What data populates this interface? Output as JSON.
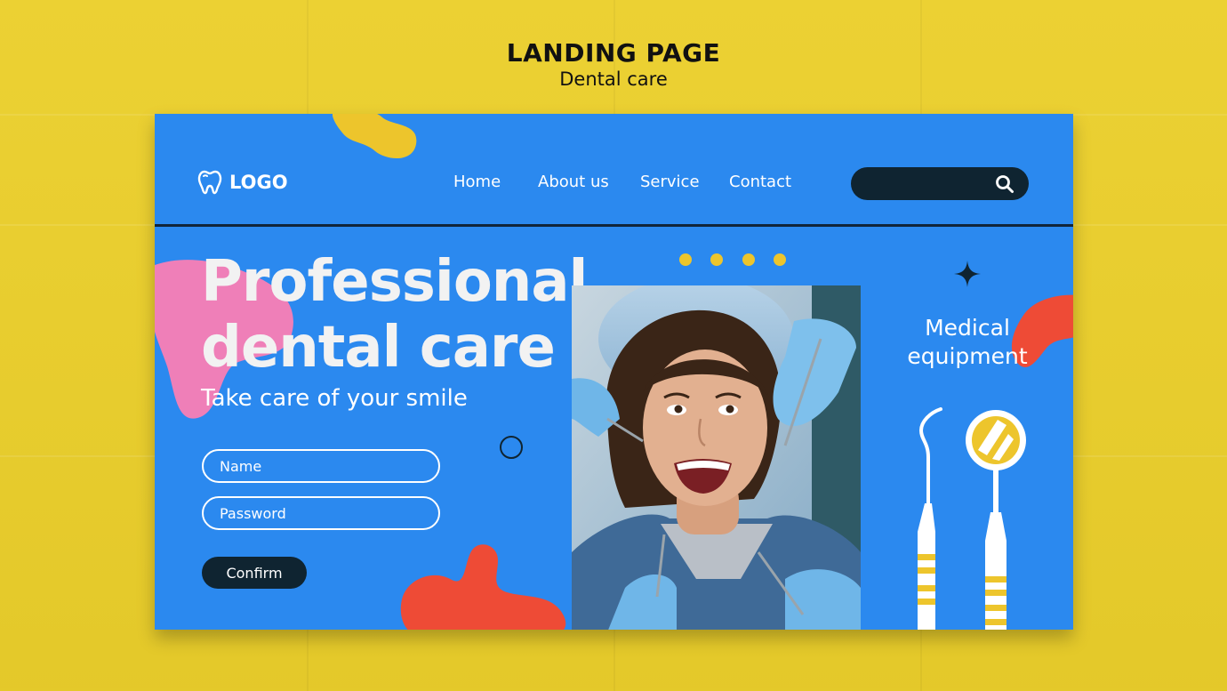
{
  "mockup": {
    "title": "LANDING PAGE",
    "subtitle": "Dental care"
  },
  "nav": {
    "logo_text": "LOGO",
    "links": [
      "Home",
      "About us",
      "Service",
      "Contact"
    ],
    "search_placeholder": ""
  },
  "hero": {
    "title_line1": "Professional",
    "title_line2": "dental care",
    "subtitle": "Take care of your smile"
  },
  "form": {
    "name_placeholder": "Name",
    "password_placeholder": "Password",
    "confirm_label": "Confirm"
  },
  "side": {
    "title_line1": "Medical",
    "title_line2": "equipment"
  },
  "colors": {
    "background": "#ebcf2b",
    "card": "#2b89ef",
    "dark": "#0f2431",
    "accent_yellow": "#edc52c",
    "accent_pink": "#ef7fb8",
    "accent_red": "#ee4b36"
  },
  "icons": [
    "tooth-icon",
    "search-icon",
    "sparkle-icon",
    "dental-probe-icon",
    "dental-mirror-icon"
  ]
}
